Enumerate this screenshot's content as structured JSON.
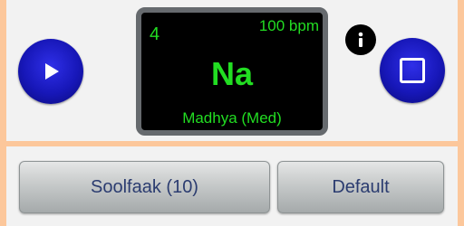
{
  "display": {
    "beat_count": "4",
    "tempo": "100 bpm",
    "syllable": "Na",
    "laya": "Madhya (Med)"
  },
  "controls": {
    "play_icon": "play-icon",
    "stop_icon": "stop-icon",
    "info_icon": "info-icon"
  },
  "buttons": {
    "theka_label": "Soolfaak (10)",
    "default_label": "Default"
  },
  "colors": {
    "background": "#fcc79b",
    "panel": "#f2f2f2",
    "display_text": "#22dd22",
    "control_blue": "#1717b8",
    "button_text": "#2b3c70"
  }
}
